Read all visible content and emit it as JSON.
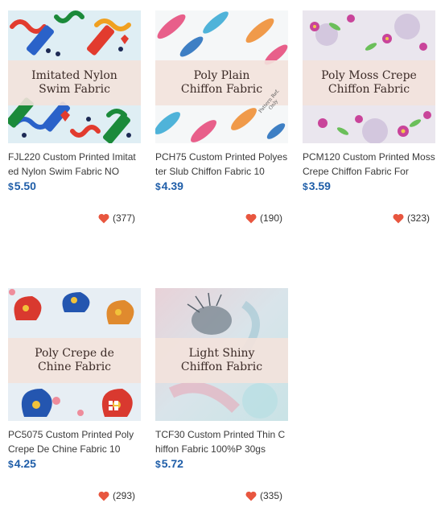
{
  "products": [
    {
      "banner": [
        "Imitated Nylon",
        "Swim Fabric"
      ],
      "title": "FJL220 Custom Printed Imitated Nylon Swim Fabric NO",
      "currency": "$",
      "price": "5.50",
      "likes": "(377)",
      "pattern": "swim"
    },
    {
      "banner": [
        "Poly Plain",
        "Chiffon Fabric"
      ],
      "title": "PCH75 Custom Printed Polyester Slub Chiffon Fabric 10",
      "currency": "$",
      "price": "4.39",
      "likes": "(190)",
      "pattern": "feather",
      "stamp": [
        "Pattern Ref.",
        "Only"
      ]
    },
    {
      "banner": [
        "Poly Moss Crepe",
        "Chiffon Fabric"
      ],
      "title": "PCM120 Custom Printed Moss Crepe Chiffon Fabric For",
      "currency": "$",
      "price": "3.59",
      "likes": "(323)",
      "pattern": "floral"
    },
    {
      "banner": [
        "Poly Crepe de",
        "Chine Fabric"
      ],
      "title": "PC5075 Custom Printed Poly Crepe De Chine Fabric 10",
      "currency": "$",
      "price": "4.25",
      "likes": "(293)",
      "pattern": "paisley"
    },
    {
      "banner": [
        "Light Shiny",
        "Chiffon Fabric"
      ],
      "title": "TCF30 Custom Printed Thin Chiffon Fabric 100%P 30gs",
      "currency": "$",
      "price": "5.72",
      "likes": "(335)",
      "pattern": "pastel"
    }
  ],
  "colors": {
    "price": "#1e5da8",
    "heart": "#e8563f",
    "banner_bg": "#f3e2dc"
  },
  "icons": {
    "like": "heart-icon"
  }
}
